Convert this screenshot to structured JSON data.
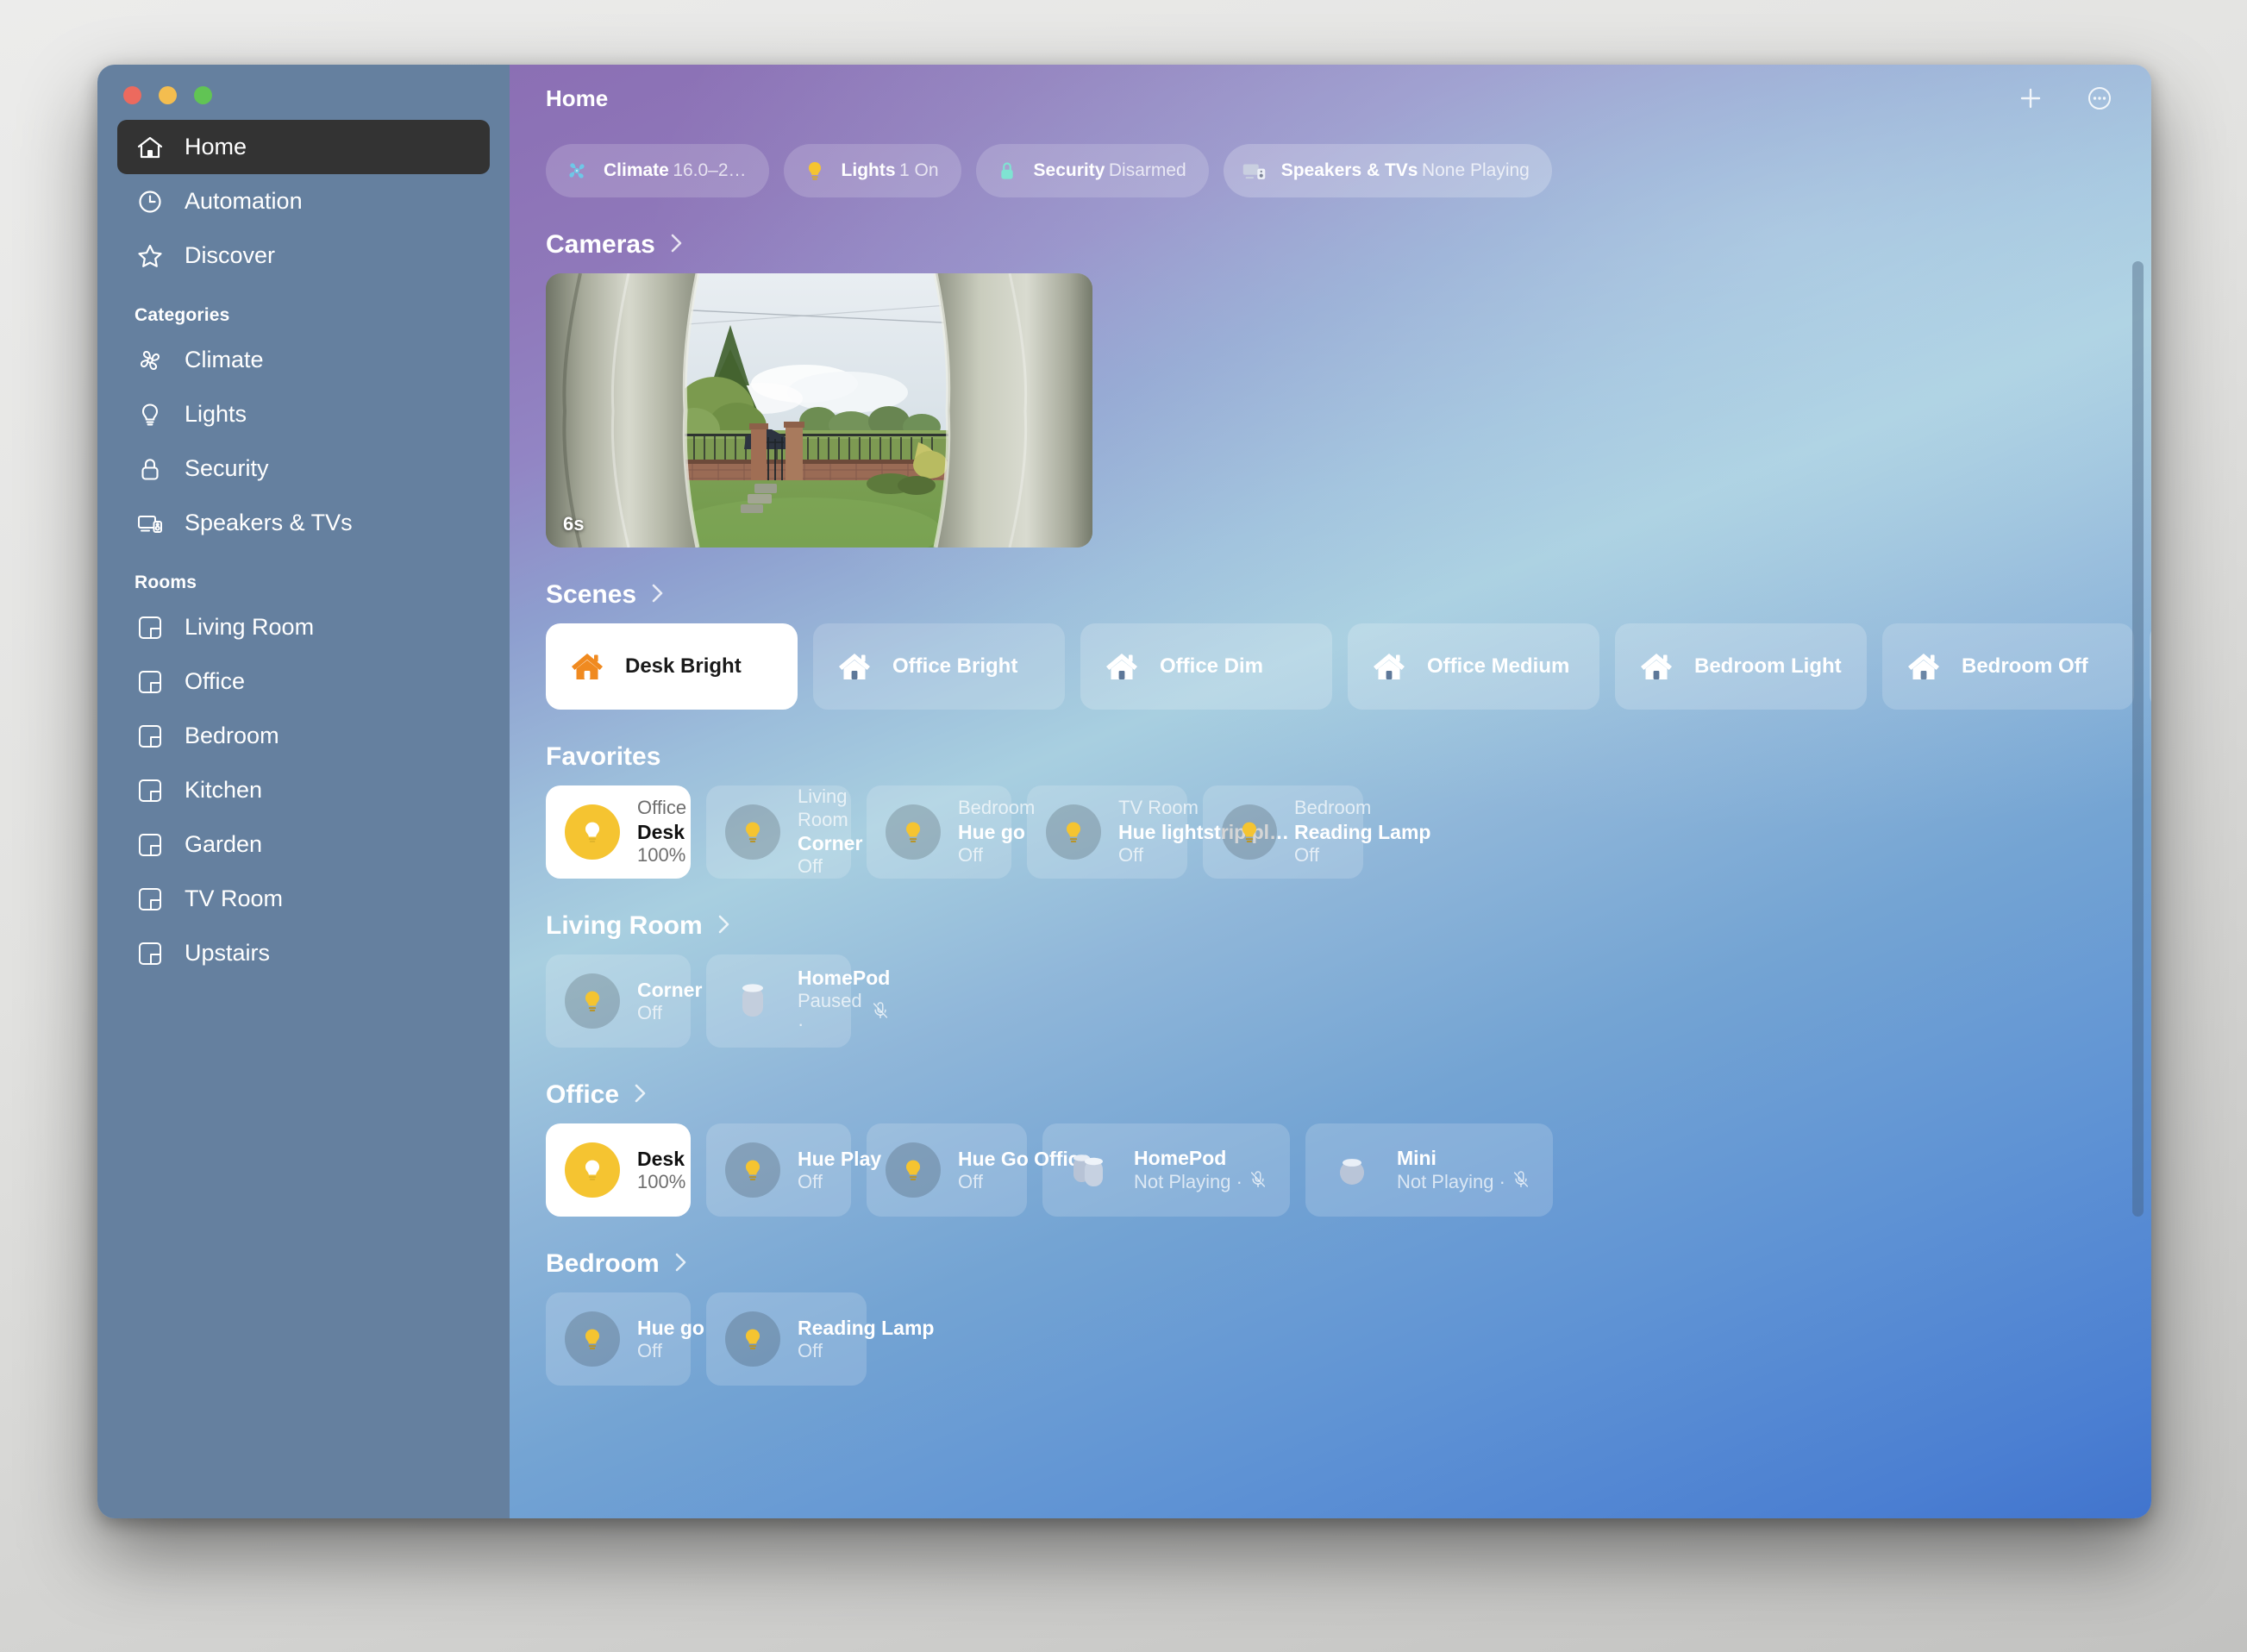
{
  "window": {
    "title": "Home",
    "traffic_lights": [
      "close",
      "minimize",
      "zoom"
    ],
    "toolbar": {
      "add_label": "+",
      "more_label": "⋯"
    }
  },
  "sidebar": {
    "primary": [
      {
        "label": "Home",
        "icon": "house-icon",
        "active": true
      },
      {
        "label": "Automation",
        "icon": "clock-icon",
        "active": false
      },
      {
        "label": "Discover",
        "icon": "star-icon",
        "active": false
      }
    ],
    "categories_header": "Categories",
    "categories": [
      {
        "label": "Climate",
        "icon": "fan-icon"
      },
      {
        "label": "Lights",
        "icon": "bulb-icon"
      },
      {
        "label": "Security",
        "icon": "lock-icon"
      },
      {
        "label": "Speakers & TVs",
        "icon": "speaker-tv-icon"
      }
    ],
    "rooms_header": "Rooms",
    "rooms": [
      {
        "label": "Living Room",
        "icon": "room-icon"
      },
      {
        "label": "Office",
        "icon": "room-icon"
      },
      {
        "label": "Bedroom",
        "icon": "room-icon"
      },
      {
        "label": "Kitchen",
        "icon": "room-icon"
      },
      {
        "label": "Garden",
        "icon": "room-icon"
      },
      {
        "label": "TV Room",
        "icon": "room-icon"
      },
      {
        "label": "Upstairs",
        "icon": "room-icon"
      }
    ]
  },
  "status_pills": [
    {
      "title": "Climate",
      "subtitle": "16.0–2…",
      "icon": "fan-icon",
      "color": "#6ec8e8"
    },
    {
      "title": "Lights",
      "subtitle": "1 On",
      "icon": "bulb-icon",
      "color": "#f5c431"
    },
    {
      "title": "Security",
      "subtitle": "Disarmed",
      "icon": "lock-icon",
      "color": "#7fe3d2"
    },
    {
      "title": "Speakers & TVs",
      "subtitle": "None Playing",
      "icon": "speaker-tv-icon",
      "color": "#c9cfe0"
    }
  ],
  "sections": {
    "cameras": {
      "title": "Cameras",
      "camera": {
        "timestamp": "6s",
        "scene": "garden-view-fisheye"
      }
    },
    "scenes": {
      "title": "Scenes",
      "items": [
        {
          "label": "Desk Bright",
          "active": true
        },
        {
          "label": "Office Bright",
          "active": false
        },
        {
          "label": "Office Dim",
          "active": false
        },
        {
          "label": "Office Medium",
          "active": false
        },
        {
          "label": "Bedroom Light",
          "active": false
        },
        {
          "label": "Bedroom Off",
          "active": false
        }
      ]
    },
    "favorites": {
      "title": "Favorites",
      "items": [
        {
          "room": "Office",
          "name": "Desk",
          "state": "100%",
          "on": true,
          "type": "light"
        },
        {
          "room": "Living Room",
          "name": "Corner",
          "state": "Off",
          "on": false,
          "type": "light"
        },
        {
          "room": "Bedroom",
          "name": "Hue go",
          "state": "Off",
          "on": false,
          "type": "light"
        },
        {
          "room": "TV Room",
          "name": "Hue lightstrip pl…",
          "state": "Off",
          "on": false,
          "type": "light"
        },
        {
          "room": "Bedroom",
          "name": "Reading Lamp",
          "state": "Off",
          "on": false,
          "type": "light"
        }
      ]
    },
    "living_room": {
      "title": "Living Room",
      "items": [
        {
          "name": "Corner",
          "state": "Off",
          "on": false,
          "type": "light"
        },
        {
          "name": "HomePod",
          "state": "Paused ·",
          "on": false,
          "type": "homepod",
          "muted": true
        }
      ]
    },
    "office": {
      "title": "Office",
      "items": [
        {
          "name": "Desk",
          "state": "100%",
          "on": true,
          "type": "light"
        },
        {
          "name": "Hue Play",
          "state": "Off",
          "on": false,
          "type": "light"
        },
        {
          "name": "Hue Go Office",
          "state": "Off",
          "on": false,
          "type": "light"
        },
        {
          "name": "HomePod",
          "state": "Not Playing ·",
          "on": false,
          "type": "homepod-pair",
          "muted": true
        },
        {
          "name": "Mini",
          "state": "Not Playing ·",
          "on": false,
          "type": "homepod-mini",
          "muted": true
        }
      ]
    },
    "bedroom": {
      "title": "Bedroom",
      "items": [
        {
          "name": "Hue go",
          "state": "Off",
          "on": false,
          "type": "light"
        },
        {
          "name": "Reading Lamp",
          "state": "Off",
          "on": false,
          "type": "light"
        }
      ]
    }
  },
  "colors": {
    "sidebar_bg": "#65809f",
    "active_item": "#333333",
    "bulb_on": "#f5c431",
    "scene_on_icon": "#f08a20",
    "gradient_start": "#8b6fb4",
    "gradient_end": "#4174cd"
  }
}
